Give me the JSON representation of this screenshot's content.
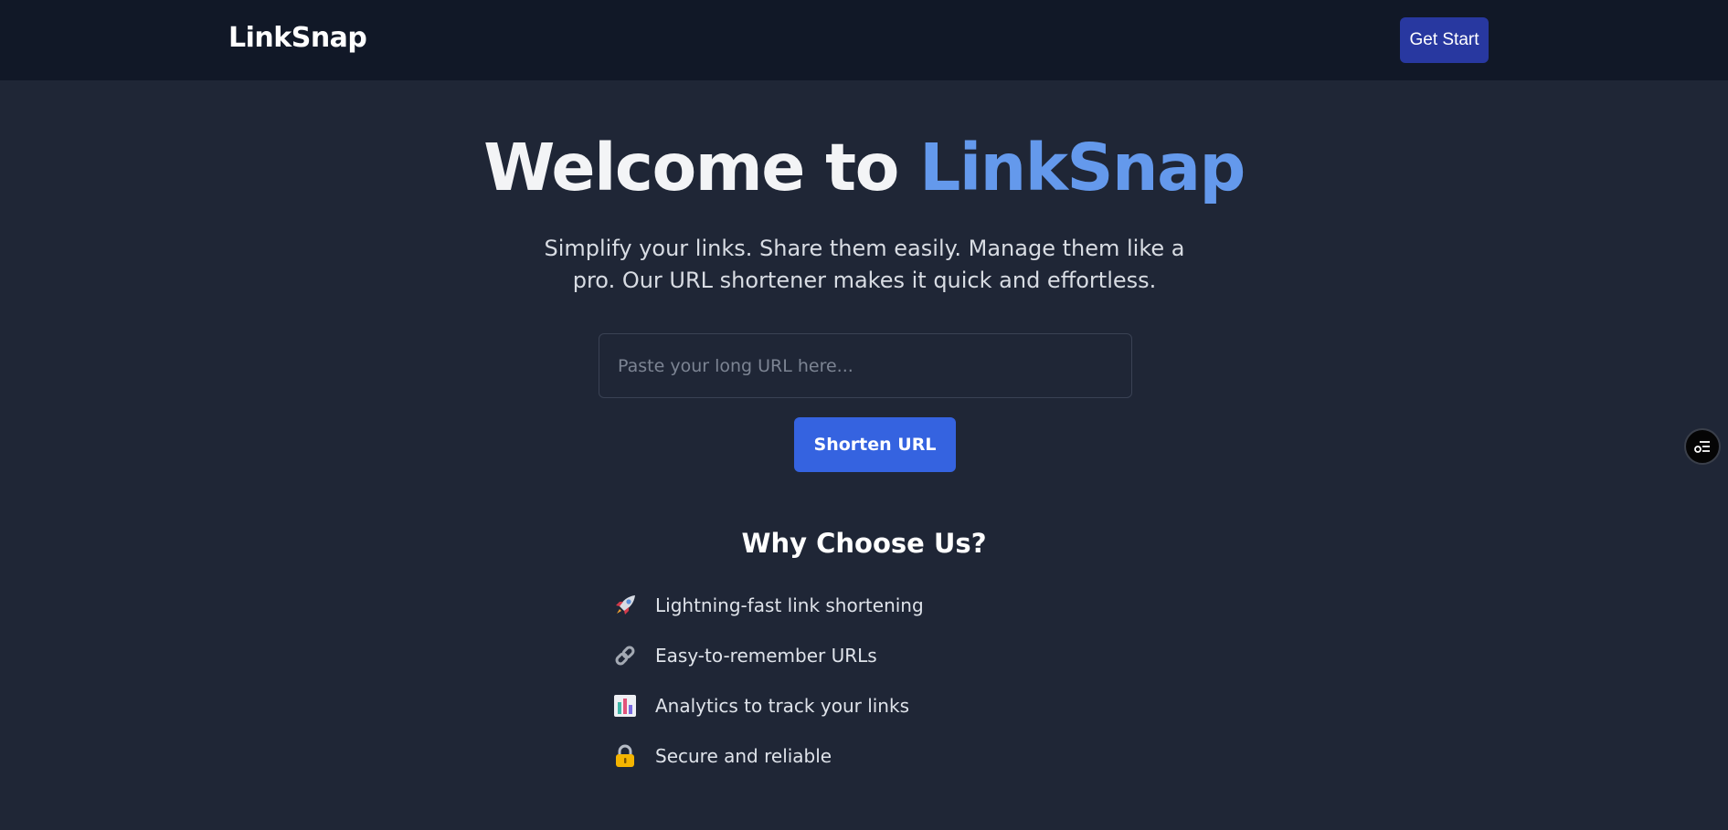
{
  "header": {
    "brand": "LinkSnap",
    "cta_label": "Get Start"
  },
  "hero": {
    "title_prefix": "Welcome to ",
    "title_accent": "LinkSnap",
    "subtitle": "Simplify your links. Share them easily. Manage them like a pro. Our URL shortener makes it quick and effortless.",
    "input_placeholder": "Paste your long URL here...",
    "input_value": "",
    "submit_label": "Shorten URL"
  },
  "why": {
    "title": "Why Choose Us?",
    "features": [
      {
        "icon": "rocket-icon",
        "label": "Lightning-fast link shortening"
      },
      {
        "icon": "link-icon",
        "label": "Easy-to-remember URLs"
      },
      {
        "icon": "bar-chart-icon",
        "label": "Analytics to track your links"
      },
      {
        "icon": "lock-icon",
        "label": "Secure and reliable"
      }
    ]
  },
  "floating": {
    "icon": "filter-settings-icon"
  },
  "colors": {
    "page_bg": "#1f2636",
    "header_bg": "#111827",
    "accent": "#6499ec",
    "primary_button": "#3563e0",
    "cta_button": "#2838a0"
  }
}
